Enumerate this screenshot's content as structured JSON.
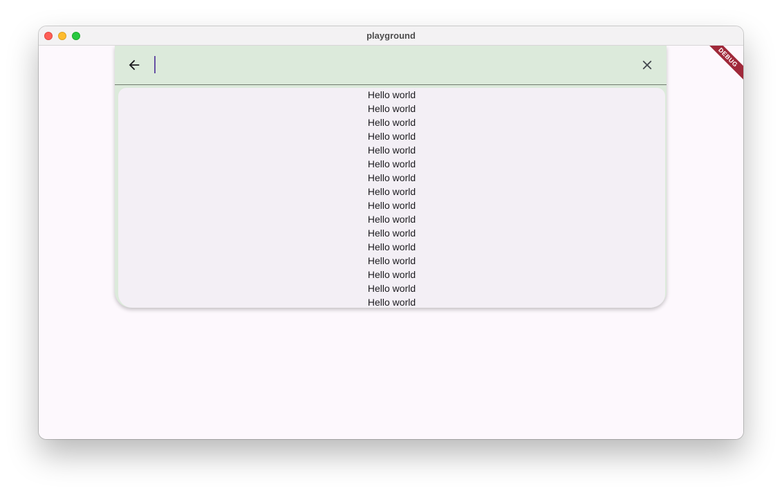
{
  "window": {
    "title": "playground"
  },
  "search": {
    "value": "",
    "placeholder": "",
    "back_icon": "arrow-back-icon",
    "clear_icon": "close-icon"
  },
  "results": [
    "Hello world",
    "Hello world",
    "Hello world",
    "Hello world",
    "Hello world",
    "Hello world",
    "Hello world",
    "Hello world",
    "Hello world",
    "Hello world",
    "Hello world",
    "Hello world",
    "Hello world",
    "Hello world",
    "Hello world",
    "Hello world"
  ],
  "debug_banner": {
    "label": "DEBUG"
  },
  "colors": {
    "header_bg": "#dceadb",
    "results_bg": "#f3eff5",
    "caret": "#6750a4",
    "debug": "#a0293a"
  }
}
